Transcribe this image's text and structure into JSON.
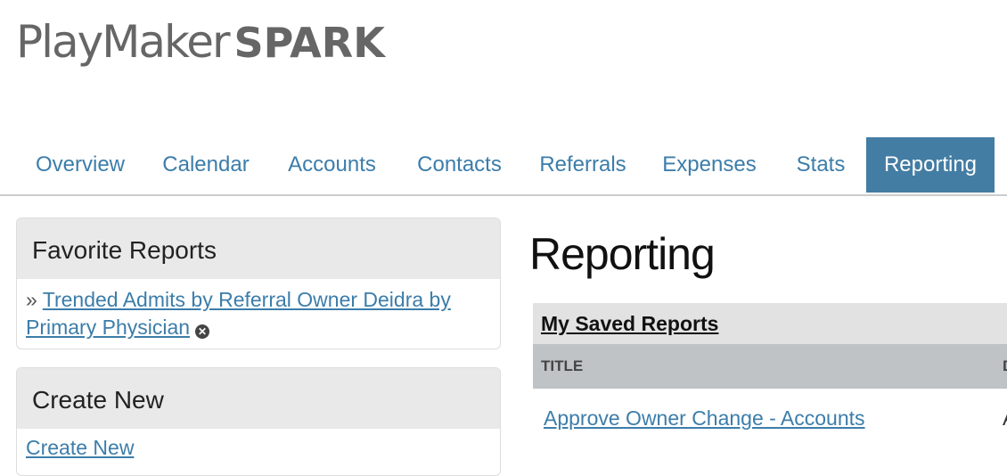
{
  "logo": {
    "main": "PlayMaker",
    "accent": "SPARK"
  },
  "nav": {
    "tabs": [
      {
        "label": "Overview"
      },
      {
        "label": "Calendar"
      },
      {
        "label": "Accounts"
      },
      {
        "label": "Contacts"
      },
      {
        "label": "Referrals"
      },
      {
        "label": "Expenses"
      },
      {
        "label": "Stats"
      },
      {
        "label": "Reporting"
      }
    ],
    "active_tab": "Reporting"
  },
  "favorites": {
    "title": "Favorite Reports",
    "bullet": "»",
    "items": [
      {
        "label": "Trended Admits by Referral Owner Deidra by Primary Physician"
      }
    ]
  },
  "create_new": {
    "title": "Create New",
    "link": "Create New"
  },
  "main": {
    "title": "Reporting",
    "saved_reports": {
      "title": "My Saved Reports",
      "columns": [
        "TITLE",
        "D"
      ],
      "rows": [
        {
          "title": "Approve Owner Change - Accounts",
          "second": "A"
        }
      ]
    }
  },
  "colors": {
    "brand_blue": "#447da4",
    "link_blue": "#3c7daa",
    "header_gray": "#e9e9e9",
    "column_gray": "#bfc3c6"
  },
  "icons": {
    "remove": "remove-circle-icon"
  }
}
